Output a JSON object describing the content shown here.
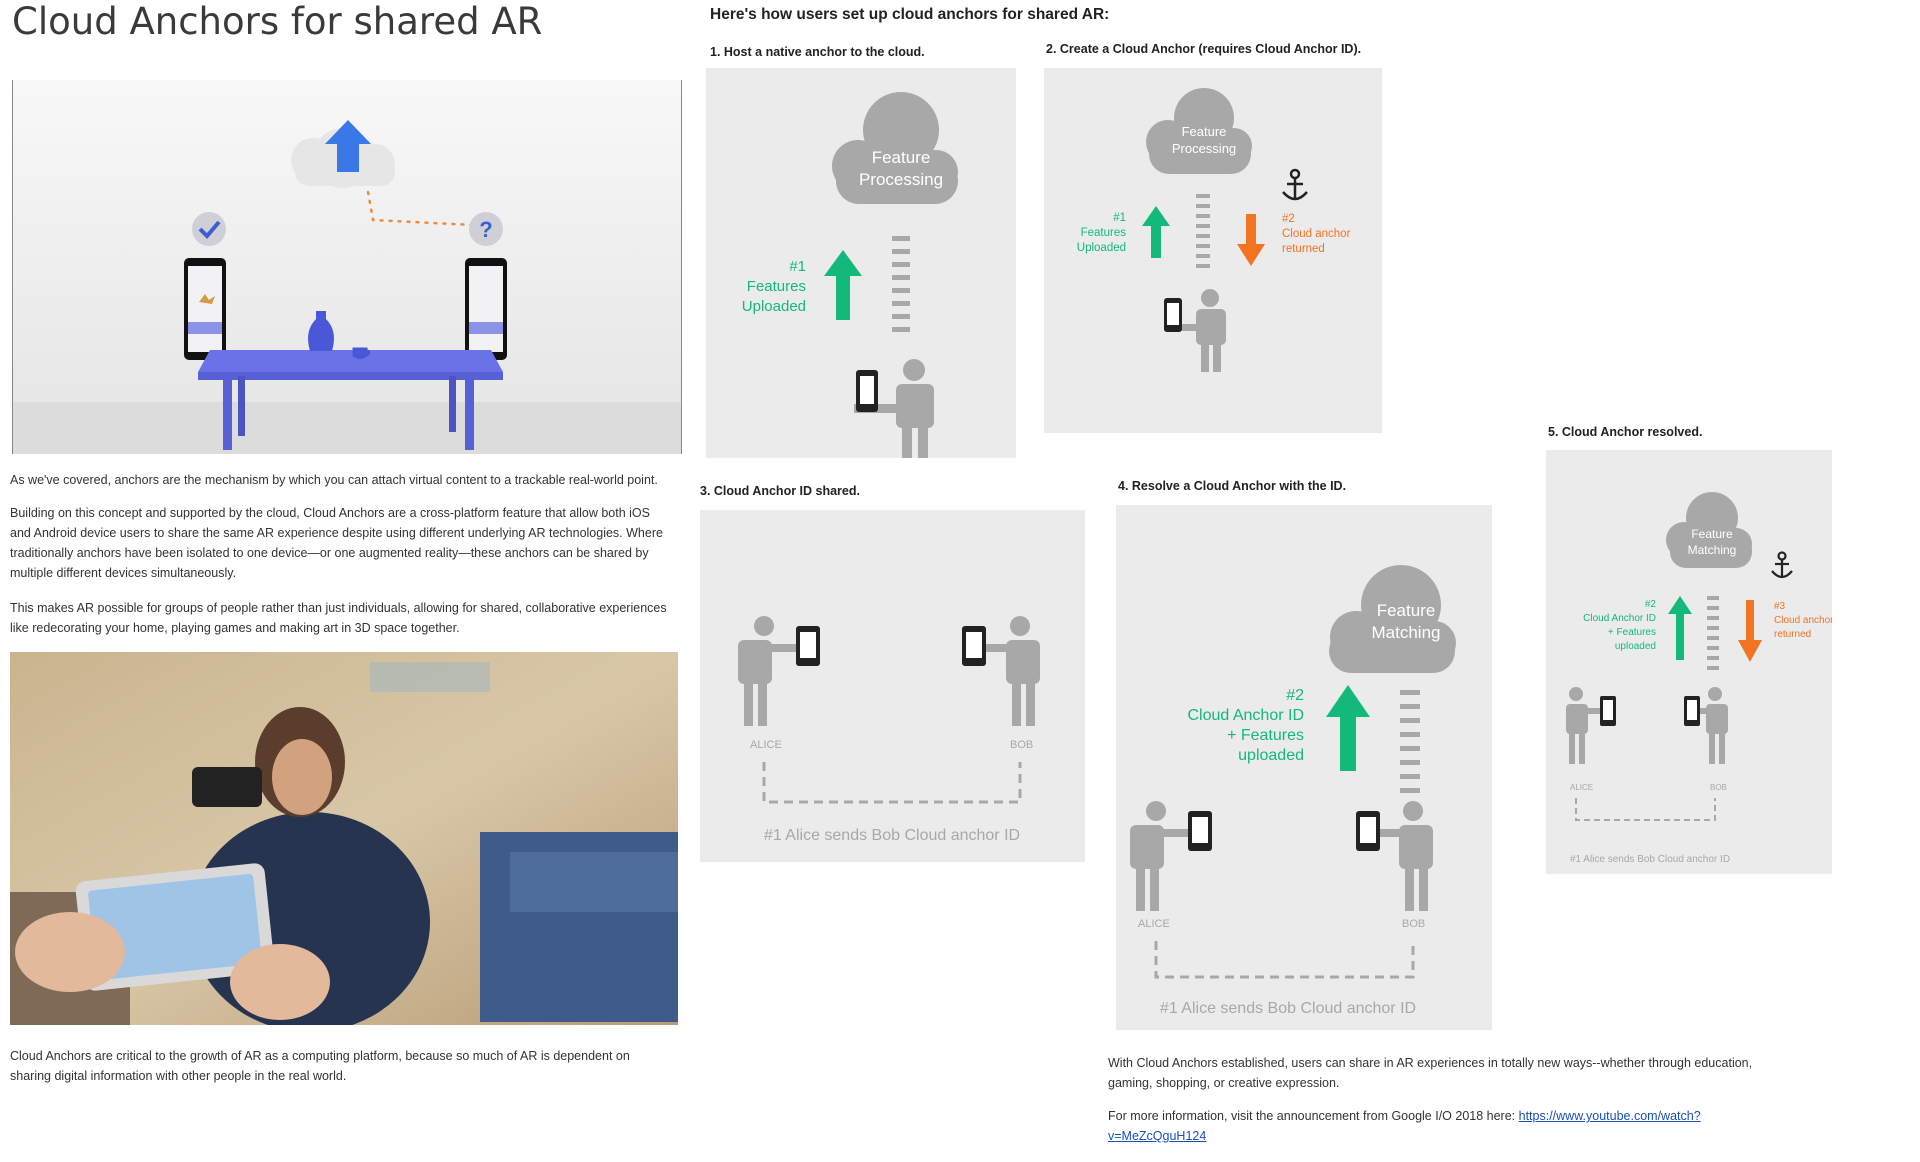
{
  "page": {
    "title": "Cloud Anchors for shared AR",
    "intro_heading": "Here's how users set up cloud anchors for shared AR:"
  },
  "paragraphs": {
    "p1": "As we've covered, anchors are the mechanism by which you can attach virtual content to a trackable real-world point.",
    "p2": "Building on this concept and supported by the cloud, Cloud Anchors are a cross-platform feature that allow both iOS and Android device users to share the same AR experience despite using different underlying AR technologies. Where traditionally anchors have been isolated to one device—or one augmented reality—these anchors can be shared by multiple different devices simultaneously.",
    "p3": "This makes AR possible for groups of people rather than just individuals, allowing for shared, collaborative experiences like  redecorating your home, playing games and making art in 3D space  together.",
    "p4": "Cloud Anchors are critical to the growth of AR as a computing platform, because so much of AR is dependent on sharing digital information with other people in the real world.",
    "p5": "With Cloud Anchors established, users can share in AR experiences in totally new ways--whether through education, gaming, shopping, or creative expression.",
    "p6_prefix": "For more information, visit the announcement from Google I/O 2018 here: ",
    "p6_link_line1": "https://www.youtube.com/watch?",
    "p6_link_line2": "v=MeZcQguH124"
  },
  "steps": {
    "s1": "1. Host a native anchor to the cloud.",
    "s2": "2. Create a Cloud Anchor (requires Cloud Anchor ID).",
    "s3": "3. Cloud Anchor ID shared.",
    "s4": "4. Resolve a Cloud Anchor with the ID.",
    "s5": "5. Cloud Anchor resolved."
  },
  "diagram_text": {
    "feature_processing_1": "Feature",
    "feature_processing_2": "Processing",
    "feature_matching_1": "Feature",
    "feature_matching_2": "Matching",
    "uploaded_num": "#1",
    "uploaded_1": "Features",
    "uploaded_2": "Uploaded",
    "returned_num": "#2",
    "returned_1": "Cloud anchor",
    "returned_2": "returned",
    "alice": "ALICE",
    "bob": "BOB",
    "sends": "#1 Alice sends Bob Cloud anchor ID",
    "resolve_num": "#2",
    "resolve_1": "Cloud Anchor ID",
    "resolve_2": "+ Features",
    "resolve_3": "uploaded",
    "resolved_returned_num": "#3",
    "resolved_returned_1": "Cloud anchor",
    "resolved_returned_2": "returned"
  },
  "colors": {
    "green": "#12b97a",
    "orange": "#f27322",
    "gray": "#a8a8a8",
    "panel": "#ebebeb",
    "table_blue": "#6a72e8",
    "link": "#1a4fb6"
  }
}
